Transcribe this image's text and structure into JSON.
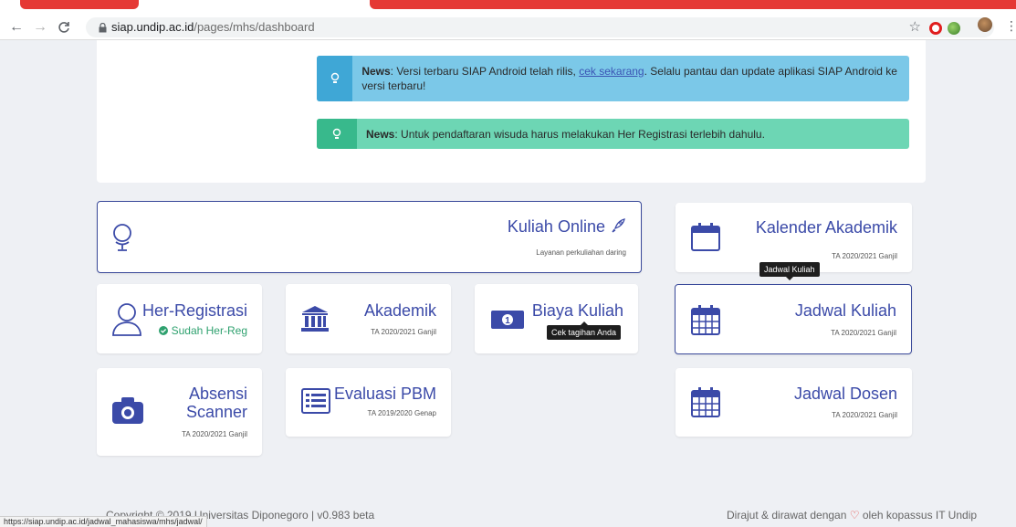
{
  "browser": {
    "url_host": "siap.undip.ac.id",
    "url_path": "/pages/mhs/dashboard",
    "back": "←",
    "forward": "→",
    "reload": "C"
  },
  "news": [
    {
      "label": "News",
      "pre": ": Versi terbaru SIAP Android telah rilis, ",
      "link": "cek sekarang",
      "post": ". Selalu pantau dan update aplikasi SIAP Android ke versi terbaru!",
      "color": "#7bc8e8"
    },
    {
      "label": "News",
      "text": ": Untuk pendaftaran wisuda harus melakukan Her Registrasi terlebih dahulu.",
      "color": "#6dd6b4"
    }
  ],
  "tiles": {
    "kuliah_online": {
      "title": "Kuliah Online",
      "sub": "Layanan perkuliahan daring"
    },
    "kalender": {
      "title": "Kalender Akademik",
      "sub": "TA 2020/2021 Ganjil"
    },
    "her_registrasi": {
      "title": "Her-Registrasi",
      "status": "Sudah Her-Reg"
    },
    "akademik": {
      "title": "Akademik",
      "sub": "TA 2020/2021 Ganjil"
    },
    "biaya": {
      "title": "Biaya Kuliah",
      "tooltip": "Cek tagihan Anda"
    },
    "jadwal_kuliah": {
      "title": "Jadwal Kuliah",
      "sub": "TA 2020/2021 Ganjil",
      "tooltip": "Jadwal Kuliah"
    },
    "absensi": {
      "title_line1": "Absensi",
      "title_line2": "Scanner",
      "sub": "TA 2020/2021 Ganjil"
    },
    "evaluasi": {
      "title": "Evaluasi PBM",
      "sub": "TA 2019/2020 Genap"
    },
    "jadwal_dosen": {
      "title": "Jadwal Dosen",
      "sub": "TA 2020/2021 Ganjil"
    }
  },
  "footer": {
    "left": "Copyright © 2019 Universitas Diponegoro | v0.983 beta",
    "right_pre": "Dirajut & dirawat dengan ",
    "right_post": " oleh kopassus IT Undip"
  },
  "status_url": "https://siap.undip.ac.id/jadwal_mahasiswa/mhs/jadwal/",
  "colors": {
    "accent": "#3b4aa8",
    "red": "#e53935"
  }
}
